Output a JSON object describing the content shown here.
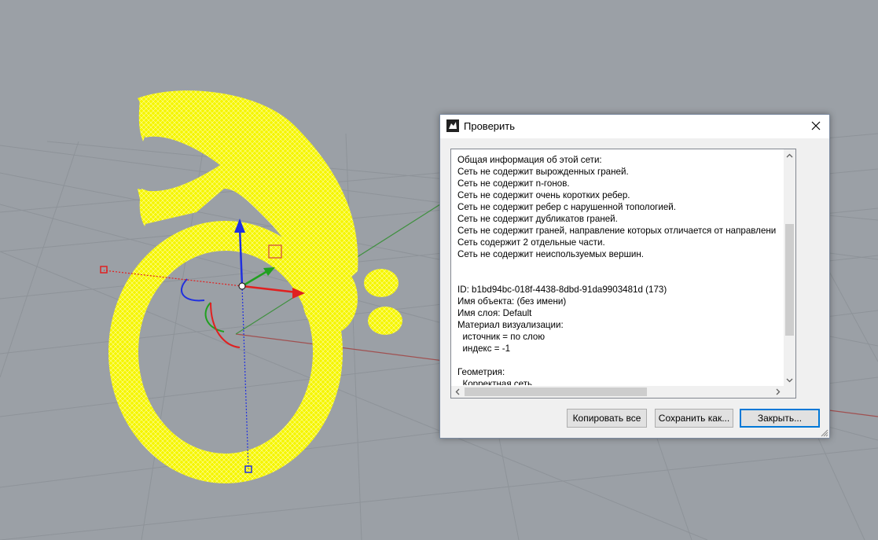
{
  "viewport": {
    "background": "#9ba0a6",
    "object_color": "#f5f500",
    "axis_colors": {
      "x": "#e02020",
      "y": "#20a020",
      "z": "#2030e0"
    }
  },
  "dialog": {
    "title": "Проверить",
    "app_icon": "rhino-icon",
    "close_icon": "close-icon",
    "report_lines": [
      "Общая информация об этой сети:",
      "Сеть не содержит вырожденных граней.",
      "Сеть не содержит n-гонов.",
      "Сеть не содержит очень коротких ребер.",
      "Сеть не содержит ребер с нарушенной топологией.",
      "Сеть не содержит дубликатов граней.",
      "Сеть не содержит граней, направление которых отличается от направлени",
      "Сеть содержит 2 отдельные части.",
      "Сеть не содержит неиспользуемых вершин.",
      "",
      "",
      "ID: b1bd94bc-018f-4438-8dbd-91da9903481d (173)",
      "Имя объекта: (без имени)",
      "Имя слоя: Default",
      "Материал визуализации:",
      "  источник = по слою",
      "  индекс = -1",
      "",
      "Геометрия:",
      "  Корректная сеть"
    ],
    "buttons": {
      "copy_all": "Копировать все",
      "save_as": "Сохранить как...",
      "close": "Закрыть..."
    }
  }
}
